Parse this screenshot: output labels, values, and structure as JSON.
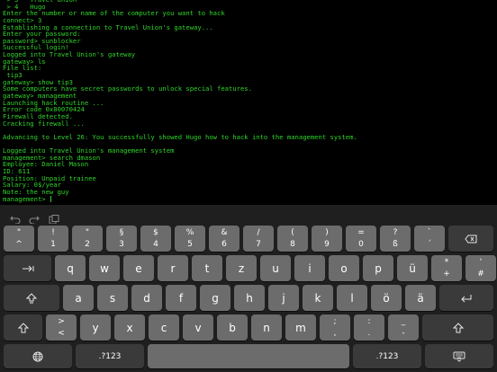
{
  "terminal": {
    "lines": [
      " > 3   Travel Union",
      " > 4   Hugo",
      "Enter the number or name of the computer you want to hack",
      "connect> 3",
      "Establishing a connection to Travel Union's gateway...",
      "Enter your password:",
      "password> sunblocker",
      "Successful login!",
      "Logged into Travel Union's gateway",
      "gateway> ls",
      "File list:",
      " tip3",
      "gateway> show tip3",
      "Some computers have secret passwords to unlock special features.",
      "gateway> management",
      "Launching hack routine ...",
      "Error code 0x80070424",
      "Firewall detected.",
      "Cracking firewall ...",
      "",
      "Advancing to Level 26: You successfully showed Hugo how to hack into the management system.",
      "",
      "Logged into Travel Union's management system",
      "management> search dmason",
      "Employee: Daniel Mason",
      "ID: 611",
      "Position: Unpaid trainee",
      "Salary: 0$/year",
      "Note: the new guy",
      "management> "
    ]
  },
  "shortcuts": {
    "undo": "undo-icon",
    "redo": "redo-icon",
    "paste": "paste-icon"
  },
  "keyboard": {
    "row1": [
      {
        "top": "\"",
        "bot": "^"
      },
      {
        "top": "!",
        "bot": "1"
      },
      {
        "top": "\"",
        "bot": "2"
      },
      {
        "top": "§",
        "bot": "3"
      },
      {
        "top": "$",
        "bot": "4"
      },
      {
        "top": "%",
        "bot": "5"
      },
      {
        "top": "&",
        "bot": "6"
      },
      {
        "top": "/",
        "bot": "7"
      },
      {
        "top": "(",
        "bot": "8"
      },
      {
        "top": ")",
        "bot": "9"
      },
      {
        "top": "=",
        "bot": "0"
      },
      {
        "top": "?",
        "bot": "ß"
      },
      {
        "top": "`",
        "bot": "´"
      }
    ],
    "row2": [
      "q",
      "w",
      "e",
      "r",
      "t",
      "z",
      "u",
      "i",
      "o",
      "p",
      "ü"
    ],
    "row2_extra": [
      {
        "top": "*",
        "bot": "+"
      },
      {
        "top": "'",
        "bot": "#"
      }
    ],
    "row3": [
      "a",
      "s",
      "d",
      "f",
      "g",
      "h",
      "j",
      "k",
      "l",
      "ö",
      "ä"
    ],
    "row4_angle": {
      "top": ">",
      "bot": "<"
    },
    "row4": [
      "y",
      "x",
      "c",
      "v",
      "b",
      "n",
      "m"
    ],
    "row4_punct": [
      {
        "top": ";",
        "bot": ","
      },
      {
        "top": ":",
        "bot": "."
      },
      {
        "top": "_",
        "bot": "-"
      }
    ],
    "numbers_left": ".?123",
    "numbers_right": ".?123",
    "icons": {
      "delete": "delete-icon",
      "tab": "tab-icon",
      "caps": "caps-lock-icon",
      "return": "return-icon",
      "shift": "shift-icon",
      "globe": "globe-icon",
      "dismiss": "keyboard-dismiss-icon"
    }
  }
}
